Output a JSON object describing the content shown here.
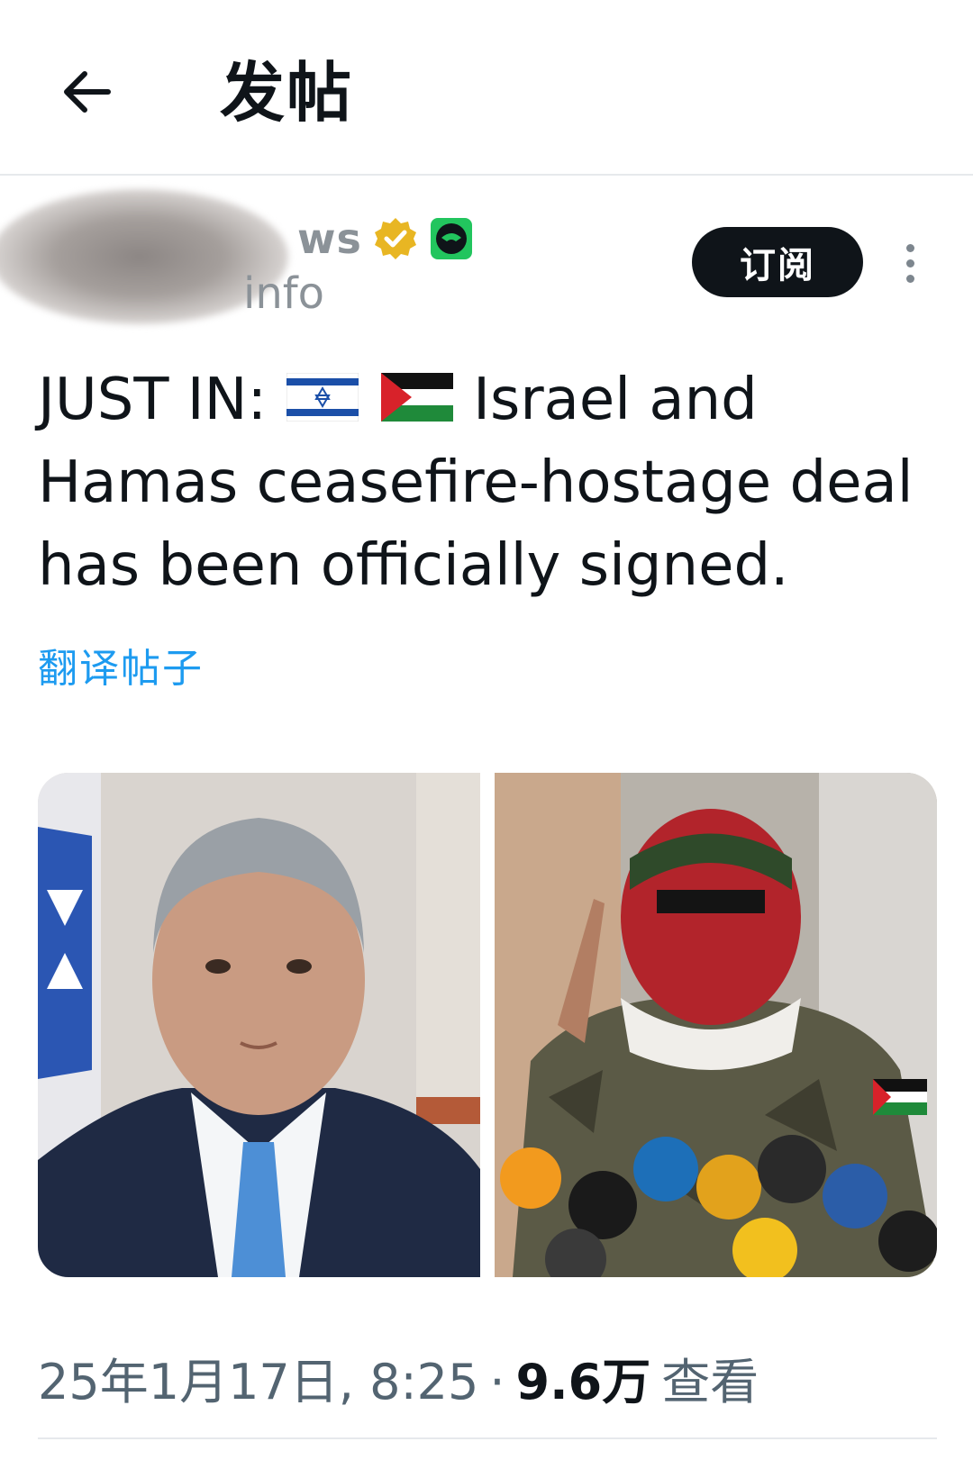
{
  "header": {
    "title": "发帖"
  },
  "author": {
    "display_name_visible": "ws",
    "handle_visible": "info",
    "subscribe_label": "订阅"
  },
  "post": {
    "text_prefix": "JUST IN:",
    "text_body": "Israel and Hamas ceasefire-hostage deal has been officially signed.",
    "translate_label": "翻译帖子",
    "flags": [
      "israel-flag",
      "palestine-flag"
    ]
  },
  "media": {
    "images": [
      "netanyahu-portrait",
      "masked-spokesman-at-podium"
    ]
  },
  "meta": {
    "timestamp": "25年1月17日, 8:25",
    "separator": "·",
    "views_count": "9.6万",
    "views_label": "查看"
  },
  "colors": {
    "accent": "#1d9bf0",
    "text": "#0f1419",
    "secondary": "#536471",
    "verified_gold": "#e8b623"
  }
}
